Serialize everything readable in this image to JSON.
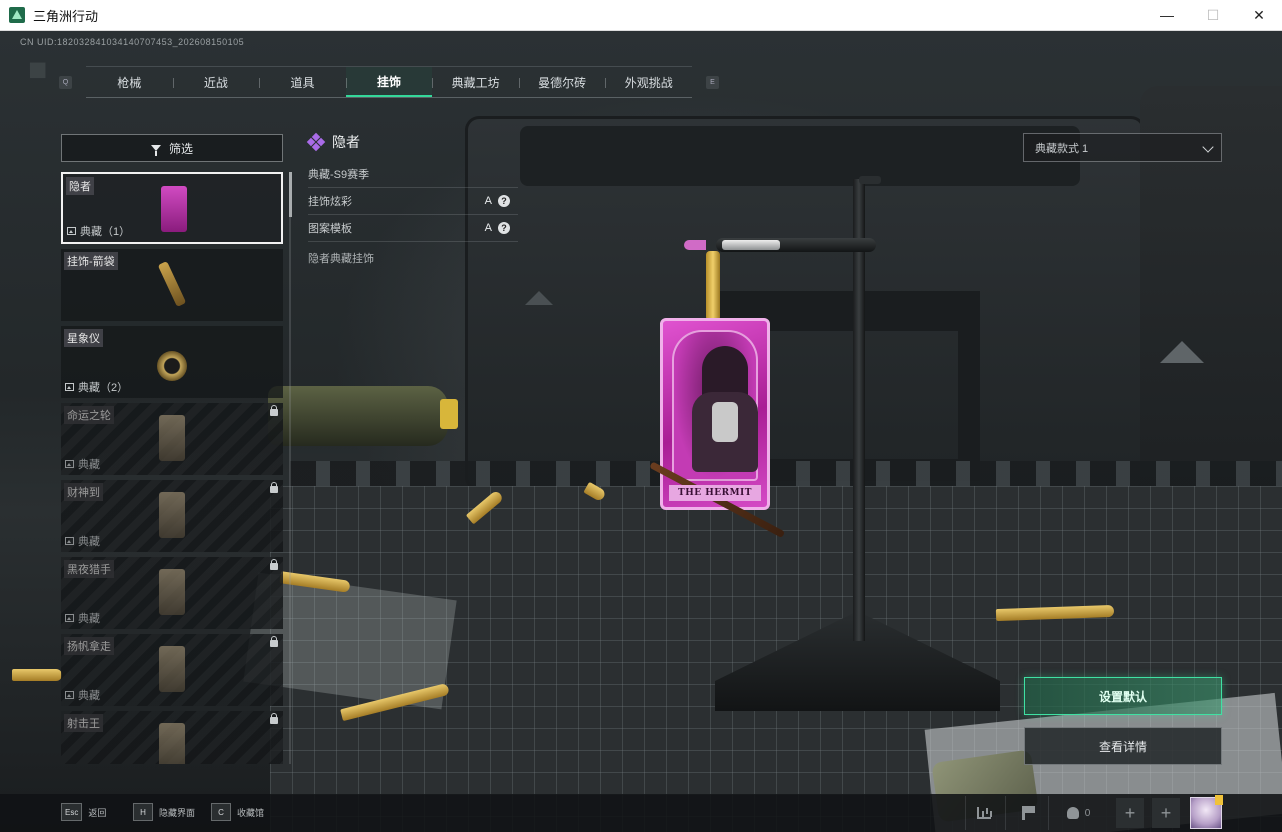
{
  "window": {
    "title": "三角洲行动",
    "controls": {
      "minimize": "—",
      "maximize": "☐",
      "close": "✕"
    }
  },
  "header": {
    "uid": "CN UID:182032841034140707453_202608150105",
    "prev_key": "Q",
    "next_key": "E",
    "tabs": [
      {
        "label": "枪械",
        "active": false
      },
      {
        "label": "近战",
        "active": false
      },
      {
        "label": "道具",
        "active": false
      },
      {
        "label": "挂饰",
        "active": true
      },
      {
        "label": "典藏工坊",
        "active": false
      },
      {
        "label": "曼德尔砖",
        "active": false
      },
      {
        "label": "外观挑战",
        "active": false
      }
    ]
  },
  "sidebar": {
    "filter_label": "筛选",
    "items": [
      {
        "name": "隐者",
        "tag": "典藏（1）",
        "locked": false,
        "selected": true,
        "thumb": "pink-card-charm"
      },
      {
        "name": "挂饰-箭袋",
        "tag": "",
        "locked": false,
        "selected": false,
        "thumb": "gold-quiver-charm"
      },
      {
        "name": "星象仪",
        "tag": "典藏（2）",
        "locked": false,
        "selected": false,
        "thumb": "astrolabe-charm"
      },
      {
        "name": "命运之轮",
        "tag": "典藏",
        "locked": true,
        "selected": false,
        "thumb": "wheel-charm"
      },
      {
        "name": "财神到",
        "tag": "典藏",
        "locked": true,
        "selected": false,
        "thumb": "fortune-charm"
      },
      {
        "name": "黑夜猎手",
        "tag": "典藏",
        "locked": true,
        "selected": false,
        "thumb": "hunter-charm"
      },
      {
        "name": "扬帆拿走",
        "tag": "典藏",
        "locked": true,
        "selected": false,
        "thumb": "sail-charm"
      },
      {
        "name": "射击王",
        "tag": "",
        "locked": true,
        "selected": false,
        "thumb": "shooter-charm"
      }
    ]
  },
  "detail": {
    "name": "隐者",
    "season": "典藏-S9赛季",
    "rows": [
      {
        "label": "挂饰炫彩",
        "grade": "A",
        "help": "?"
      },
      {
        "label": "图案模板",
        "grade": "A",
        "help": "?"
      }
    ],
    "description": "隐者典藏挂饰"
  },
  "charm": {
    "card_text": "THE HERMIT",
    "accent": "#d54ac6"
  },
  "variant_select": {
    "value": "典藏款式 1"
  },
  "actions": {
    "set_default": "设置默认",
    "view_details": "查看详情"
  },
  "bottom_hints": [
    {
      "key": "Esc",
      "label": "返回"
    },
    {
      "key": "H",
      "label": "隐藏界面"
    },
    {
      "key": "C",
      "label": "收藏馆"
    }
  ],
  "status_bar": {
    "friends_count": "0",
    "plus": "+"
  },
  "colors": {
    "accent_green": "#3fe1a3",
    "tab_active_line": "#34d89a",
    "panel_bg": "#1b1e20"
  }
}
